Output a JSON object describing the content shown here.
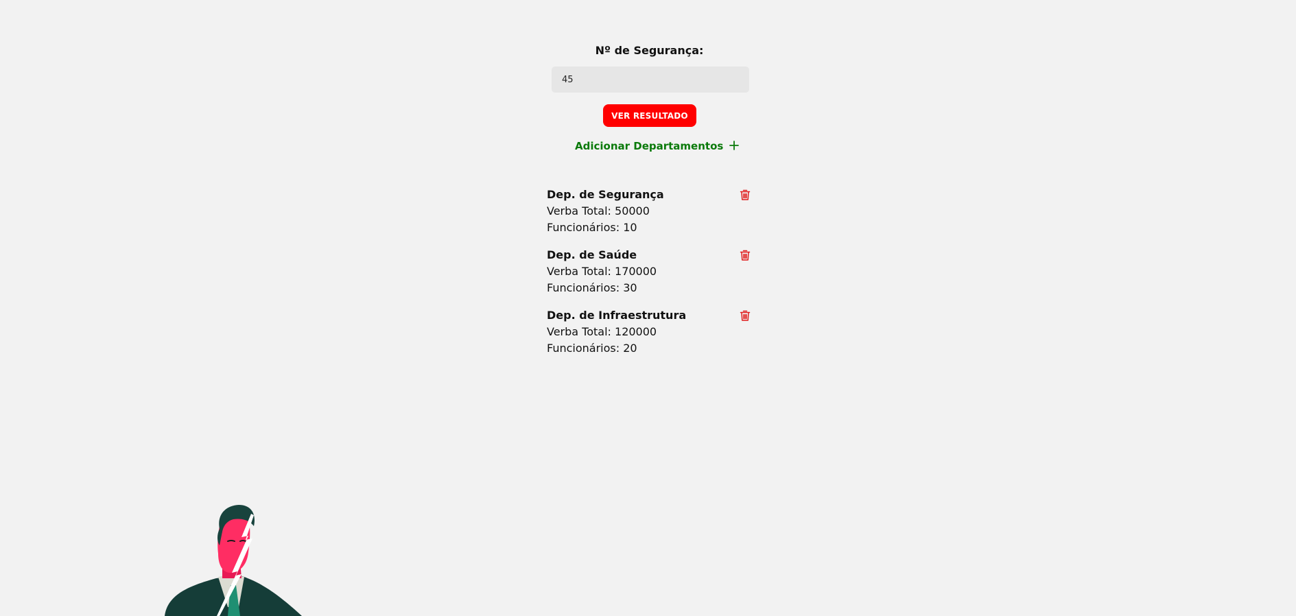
{
  "form": {
    "security_label": "Nº de Segurança:",
    "security_value": "45",
    "result_button": "VER RESULTADO",
    "add_departments_label": "Adicionar Departamentos",
    "add_icon": "plus-icon"
  },
  "departments": [
    {
      "name": "Dep. de Segurança",
      "budget": "Verba Total: 50000",
      "employees": "Funcionários: 10"
    },
    {
      "name": "Dep. de Saúde",
      "budget": "Verba Total: 170000",
      "employees": "Funcionários: 30"
    },
    {
      "name": "Dep. de Infraestrutura",
      "budget": "Verba Total: 120000",
      "employees": "Funcionários: 20"
    }
  ],
  "colors": {
    "accent_red": "#ff0000",
    "accent_green": "#0a7a0a",
    "background": "#f2f2f2"
  }
}
